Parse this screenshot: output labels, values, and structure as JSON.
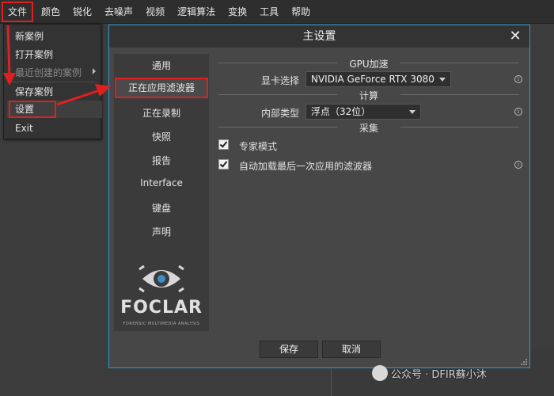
{
  "menubar": {
    "items": [
      "文件",
      "颜色",
      "锐化",
      "去噪声",
      "视频",
      "逻辑算法",
      "变换",
      "工具",
      "帮助"
    ]
  },
  "file_menu": {
    "new_case": "新案例",
    "open_case": "打开案例",
    "recent_cases": "最近创建的案例",
    "save_case": "保存案例",
    "settings": "设置",
    "exit": "Exit"
  },
  "dialog": {
    "title": "主设置",
    "nav": [
      "通用",
      "正在应用滤波器",
      "正在录制",
      "快照",
      "报告",
      "Interface",
      "键盘",
      "声明"
    ],
    "logo_text": "FOCLAR",
    "logo_sub": "FORENSIC MULTIMEDIA ANALYSIS",
    "gpu_section": "GPU加速",
    "gpu_label": "显卡选择",
    "gpu_value": "NVIDIA GeForce RTX 3080",
    "compute_section": "计算",
    "compute_label": "内部类型",
    "compute_value": "浮点（32位）",
    "capture_section": "采集",
    "expert_mode": "专家模式",
    "autoload_filter": "自动加载最后一次应用的滤波器",
    "save_button": "保存",
    "cancel_button": "取消"
  },
  "watermark": {
    "text": "公众号 · DFIR蘇小沐"
  },
  "colors": {
    "accent_border": "#2a9bd6",
    "highlight_red": "#e02020"
  }
}
